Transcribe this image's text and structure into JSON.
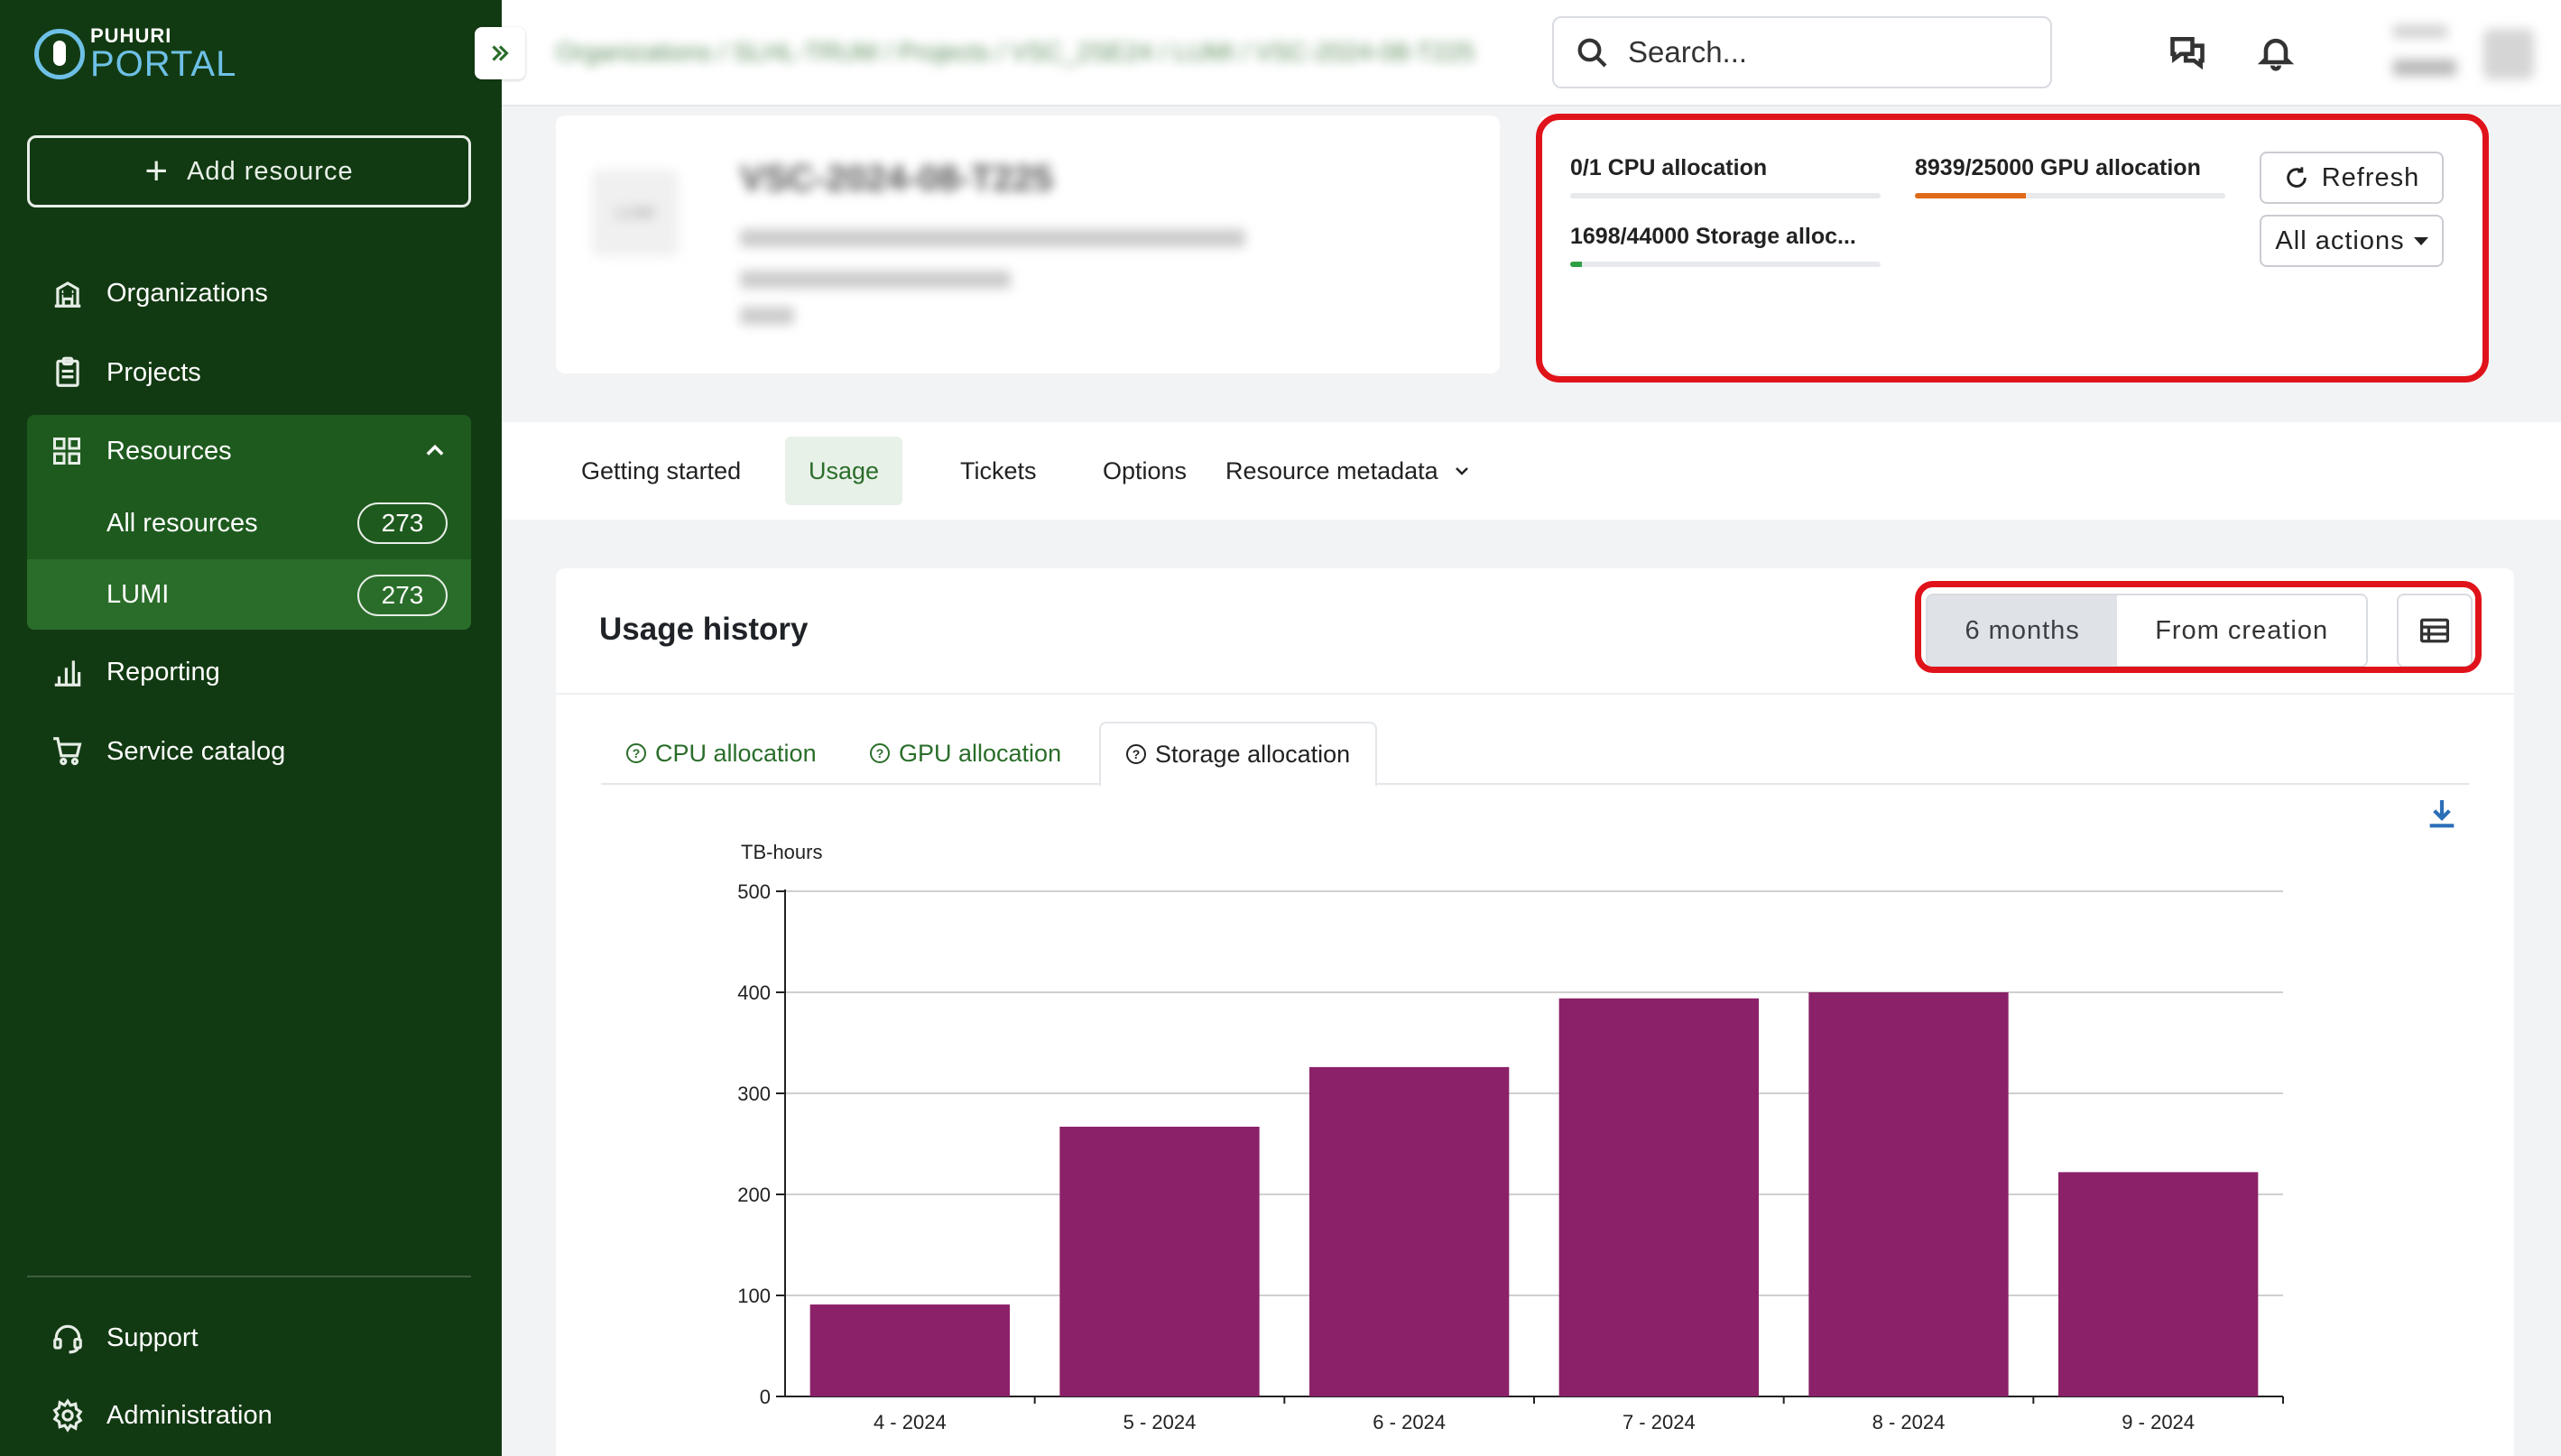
{
  "logo": {
    "small": "PUHURI",
    "big": "PORTAL"
  },
  "sidebar": {
    "add_label": "Add resource",
    "items": [
      {
        "label": "Organizations",
        "icon": "building-icon"
      },
      {
        "label": "Projects",
        "icon": "clipboard-icon"
      },
      {
        "label": "Resources",
        "icon": "grid-icon"
      },
      {
        "label": "Reporting",
        "icon": "bar-chart-icon"
      },
      {
        "label": "Service catalog",
        "icon": "cart-icon"
      }
    ],
    "resources_sub": [
      {
        "label": "All resources",
        "count": "273"
      },
      {
        "label": "LUMI",
        "count": "273"
      }
    ],
    "bottom": [
      {
        "label": "Support",
        "icon": "headset-icon"
      },
      {
        "label": "Administration",
        "icon": "gear-icon"
      }
    ]
  },
  "topbar": {
    "breadcrumb": "Organizations / SLHL-TRUM / Projects / VSC_2SE24 / LUMI / VSC-2024-08-T225",
    "search_placeholder": "Search..."
  },
  "header": {
    "logo_text": "LUMI",
    "title": "VSC-2024-08-T225"
  },
  "allocations": [
    {
      "label": "0/1 CPU allocation",
      "fraction": 0,
      "color": "#2e9e44"
    },
    {
      "label": "8939/25000 GPU allocation",
      "fraction": 0.3576,
      "color": "#e06a1a"
    },
    {
      "label": "1698/44000 Storage alloc...",
      "fraction": 0.0386,
      "color": "#2e9e44"
    }
  ],
  "actions": {
    "refresh": "Refresh",
    "all_actions": "All actions"
  },
  "tabs": [
    "Getting started",
    "Usage",
    "Tickets",
    "Options",
    "Resource metadata"
  ],
  "usage": {
    "title": "Usage history",
    "period_selected": "6 months",
    "period_other": "From creation",
    "chart_tabs": [
      "CPU allocation",
      "GPU allocation",
      "Storage allocation"
    ]
  },
  "colors": {
    "sidebar": "#123a12",
    "bar": "#8b2168",
    "highlight": "#e0131a"
  },
  "chart_data": {
    "type": "bar",
    "ylabel": "TB-hours",
    "categories": [
      "4 - 2024",
      "5 - 2024",
      "6 - 2024",
      "7 - 2024",
      "8 - 2024",
      "9 - 2024"
    ],
    "values": [
      91,
      267,
      326,
      394,
      400,
      222
    ],
    "ylim": [
      0,
      500
    ],
    "yticks": [
      0,
      100,
      200,
      300,
      400,
      500
    ],
    "grid": true
  }
}
